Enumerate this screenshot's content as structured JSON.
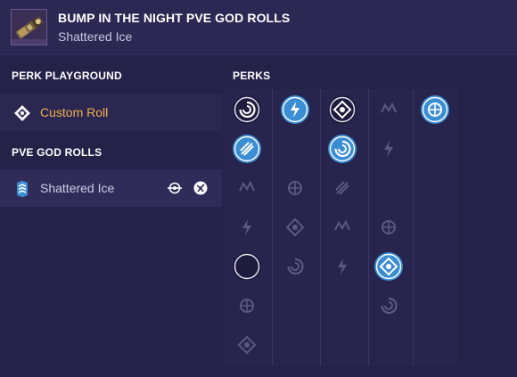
{
  "header": {
    "title": "BUMP IN THE NIGHT PVE GOD ROLLS",
    "subtitle": "Shattered Ice",
    "weapon_icon": "rocket-launcher-icon"
  },
  "sidebar": {
    "perk_playground_title": "PERK PLAYGROUND",
    "custom_roll_label": "Custom Roll",
    "custom_roll_icon": "playground-diamond-icon",
    "god_rolls_title": "PVE GOD ROLLS",
    "rolls": [
      {
        "label": "Shattered Ice",
        "icon": "chevron-rank-icon",
        "perk_icons": [
          "reload-orbit-perk-icon",
          "explosive-burst-perk-icon"
        ]
      }
    ]
  },
  "perks": {
    "title": "PERKS",
    "columns": [
      {
        "name": "barrel",
        "perks": [
          {
            "icon": "swirl-barrel-perk-icon",
            "selected": false,
            "emphasized": true
          },
          {
            "icon": "palm-barrel-perk-icon",
            "selected": true
          },
          {
            "icon": "spike-barrel-perk-icon",
            "selected": false
          },
          {
            "icon": "lightning-barrel-perk-icon",
            "selected": false
          },
          {
            "icon": "flame-barrel-perk-icon",
            "selected": false,
            "emphasized": true
          },
          {
            "icon": "arc-barrel-perk-icon",
            "selected": false
          },
          {
            "icon": "tri-barrel-perk-icon",
            "selected": false
          }
        ]
      },
      {
        "name": "magazine",
        "perks": [
          {
            "icon": "grip-magazine-perk-icon",
            "selected": true
          },
          {
            "icon": "target-magazine-perk-icon",
            "selected": false
          },
          {
            "icon": "claw-magazine-perk-icon",
            "selected": false
          },
          {
            "icon": "diamond-magazine-perk-icon",
            "selected": false
          },
          {
            "icon": "rocket-magazine-perk-icon",
            "selected": false
          }
        ]
      },
      {
        "name": "trait-1",
        "perks": [
          {
            "icon": "car-trait-perk-icon",
            "selected": false,
            "emphasized": true
          },
          {
            "icon": "explosion-trait-perk-icon",
            "selected": true
          },
          {
            "icon": "crossed-trait-perk-icon",
            "selected": false
          },
          {
            "icon": "skull-trait-perk-icon",
            "selected": false
          },
          {
            "icon": "arrow-trait-perk-icon",
            "selected": false
          },
          {
            "icon": "target-trait-perk-icon",
            "selected": false
          }
        ]
      },
      {
        "name": "trait-2",
        "perks": [
          {
            "icon": "dragon-trait-perk-icon",
            "selected": false
          },
          {
            "icon": "star-trait-perk-icon",
            "selected": false
          },
          {
            "icon": "atom-trait-perk-icon",
            "selected": false
          },
          {
            "icon": "crosshair-trait-perk-icon",
            "selected": false
          },
          {
            "icon": "orbit-trait-perk-icon",
            "selected": true
          },
          {
            "icon": "cross-trait-perk-icon",
            "selected": false
          }
        ]
      },
      {
        "name": "masterwork",
        "perks": [
          {
            "icon": "masterwork-ring-perk-icon",
            "selected": true
          }
        ]
      }
    ]
  },
  "colors": {
    "background": "#232046",
    "header": "#2b2853",
    "accent_blue": "#3b8dd4",
    "custom_roll_orange": "#f2b14a",
    "muted_icon": "#5c5880"
  }
}
